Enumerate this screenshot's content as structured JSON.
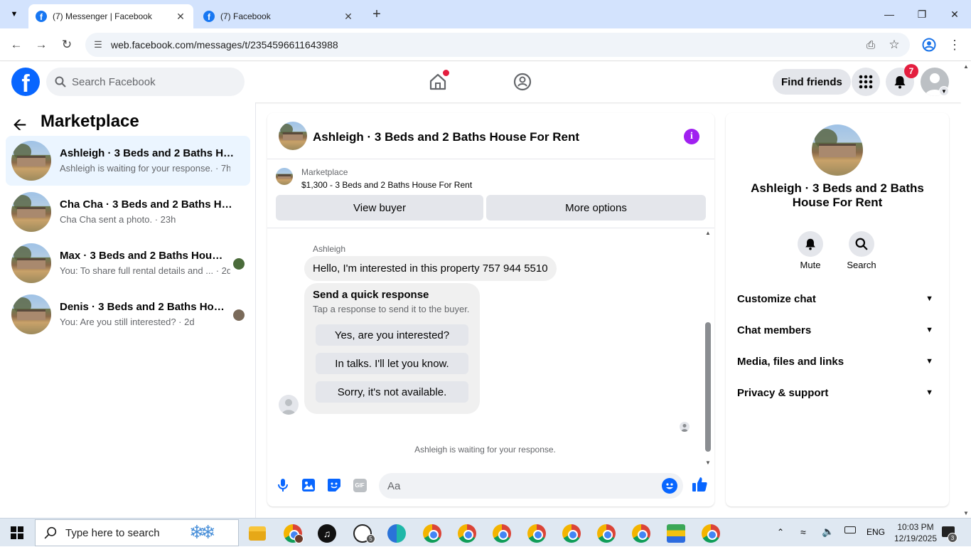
{
  "browser": {
    "tabs": [
      {
        "title": "(7) Messenger | Facebook",
        "active": true
      },
      {
        "title": "(7) Facebook",
        "active": false
      }
    ],
    "url": "web.facebook.com/messages/t/2354596611643988"
  },
  "header": {
    "search_placeholder": "Search Facebook",
    "find_friends": "Find friends",
    "notification_count": "7"
  },
  "sidebar": {
    "title": "Marketplace",
    "conversations": [
      {
        "name": "Ashleigh · 3 Beds and 2 Baths Hou...",
        "preview": "Ashleigh is waiting for your response. · 7h",
        "active": true
      },
      {
        "name": "Cha Cha · 3 Beds and 2 Baths Hou...",
        "preview": "Cha Cha sent a photo. · 23h",
        "active": false
      },
      {
        "name": "Max · 3 Beds and 2 Baths House...",
        "preview": "You: To share full rental details and ... · 2d",
        "active": false
      },
      {
        "name": "Denis · 3 Beds and 2 Baths Hous...",
        "preview": "You: Are you still interested? · 2d",
        "active": false
      }
    ]
  },
  "chat": {
    "title": "Ashleigh · 3 Beds and 2 Baths House For Rent",
    "listing_label": "Marketplace",
    "listing_price": "$1,300 - 3 Beds and 2 Baths House For Rent",
    "view_buyer": "View buyer",
    "more_options": "More options",
    "sender": "Ashleigh",
    "message": "Hello, I'm interested in this property 757 944 5510",
    "quick_title": "Send a quick response",
    "quick_sub": "Tap a response to send it to the buyer.",
    "quick_replies": [
      "Yes, are you interested?",
      "In talks. I'll let you know.",
      "Sorry, it's not available."
    ],
    "waiting": "Ashleigh is waiting for your response.",
    "composer_placeholder": "Aa"
  },
  "info_panel": {
    "name": "Ashleigh · 3 Beds and 2 Baths House For Rent",
    "mute": "Mute",
    "search": "Search",
    "sections": [
      "Customize chat",
      "Chat members",
      "Media, files and links",
      "Privacy & support"
    ]
  },
  "taskbar": {
    "search_placeholder": "Type here to search",
    "whatsapp_badge": "5",
    "language": "ENG",
    "time": "10:03 PM",
    "date": "12/19/2025",
    "notif_count": "3"
  },
  "colors": {
    "fb_blue": "#0866ff",
    "active_conv": "#ebf5ff",
    "badge_red": "#e41e3f",
    "info_purple": "#a020f0"
  }
}
